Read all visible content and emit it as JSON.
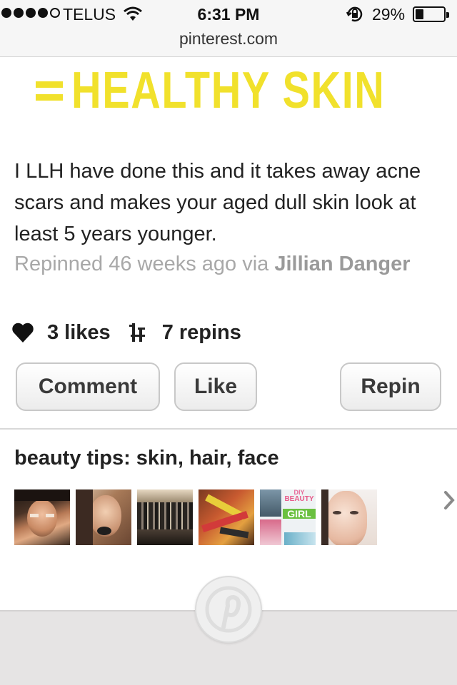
{
  "status_bar": {
    "carrier": "TELUS",
    "time": "6:31 PM",
    "battery_percent": "29%",
    "battery_level": 0.29
  },
  "browser": {
    "url": "pinterest.com"
  },
  "pin": {
    "image_text": "HEALTHY SKIN",
    "image_equals": "=",
    "description": "I LLH have done this and it takes away acne scars and makes your aged dull skin look at least 5 years younger.",
    "repinned_prefix": "Repinned 46 weeks ago via",
    "repinned_user": "Jillian Danger",
    "likes": "3 likes",
    "repins": "7 repins"
  },
  "actions": {
    "comment_label": "Comment",
    "like_label": "Like",
    "repin_label": "Repin"
  },
  "board": {
    "title": "beauty tips: skin, hair, face",
    "thumbnails": [
      "contour-makeup",
      "makeup-sponge",
      "brush-set",
      "lipsticks-mascara",
      "diy-beauty-girl",
      "face-mask"
    ],
    "thumb_text": {
      "l1": "DIY",
      "l2": "BEAUTY",
      "l3": "GIRL"
    }
  },
  "colors": {
    "hero_yellow": "#f1e12c",
    "meta_grey": "#a8a8a8",
    "bottom_bar": "#e6e4e4"
  }
}
